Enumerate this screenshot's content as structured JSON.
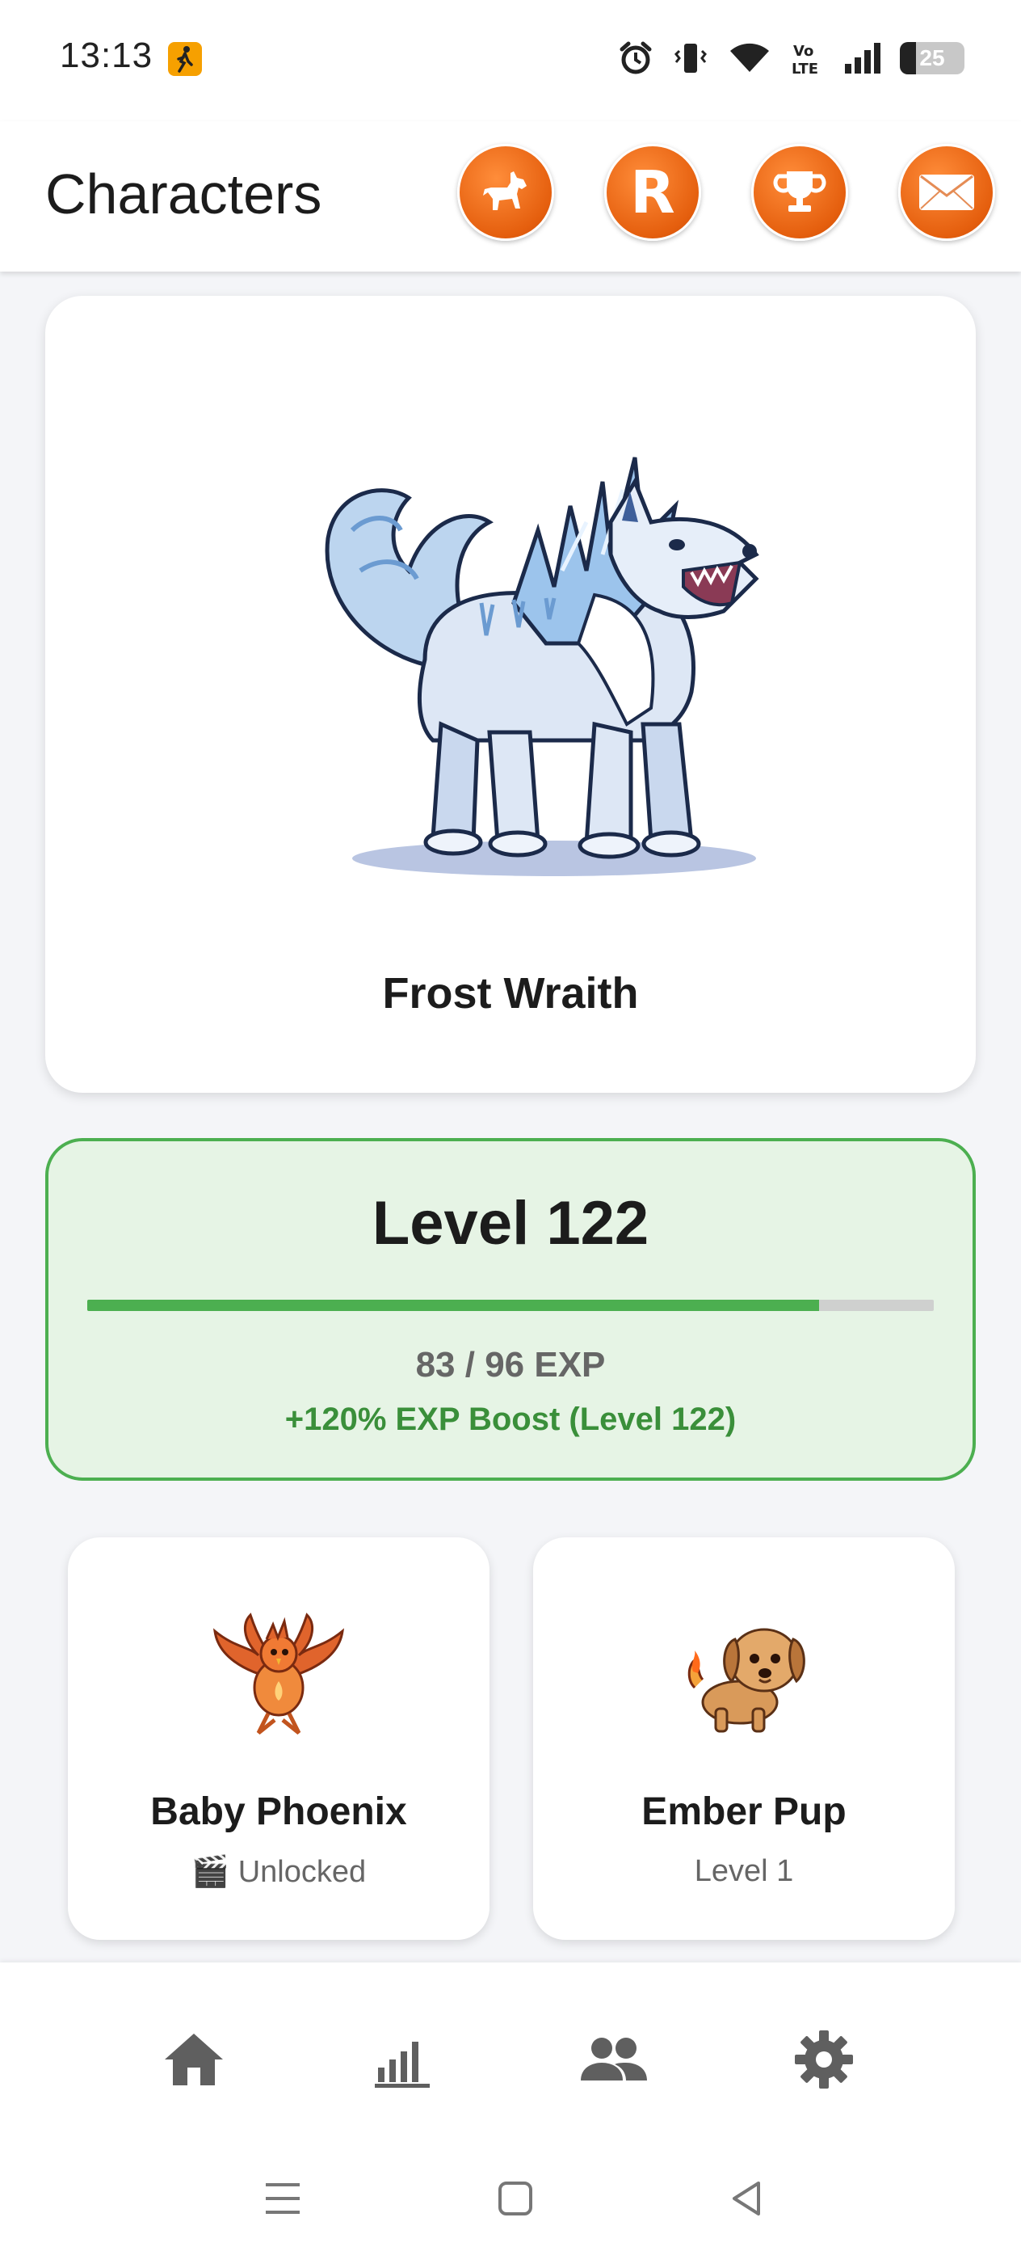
{
  "status_bar": {
    "time": "13:13",
    "battery": "25",
    "battery_level": 0.25,
    "icons": [
      "pedestrian-icon",
      "alarm-icon",
      "vibrate-icon",
      "wifi-icon",
      "volte-icon",
      "signal-icon",
      "battery-icon"
    ]
  },
  "header": {
    "title": "Characters",
    "buttons": [
      {
        "name": "dog-icon"
      },
      {
        "name": "r-icon",
        "label": "R"
      },
      {
        "name": "trophy-icon"
      },
      {
        "name": "mail-icon"
      }
    ],
    "accent": "#e8631a"
  },
  "character": {
    "name": "Frost Wraith",
    "art": "ice-wolf"
  },
  "level": {
    "title": "Level 122",
    "exp": "83 / 96 EXP",
    "exp_current": 83,
    "exp_max": 96,
    "boost": "+120% EXP Boost (Level 122)",
    "color": "#4caf50"
  },
  "characters": [
    {
      "name": "Baby Phoenix",
      "status": "🎬 Unlocked"
    },
    {
      "name": "Ember Pup",
      "status": "Level 1"
    }
  ],
  "bottom_nav": {
    "items": [
      "home-icon",
      "stats-icon",
      "friends-icon",
      "settings-icon"
    ]
  },
  "system_nav": [
    "menu-icon",
    "home-square-icon",
    "back-icon"
  ]
}
